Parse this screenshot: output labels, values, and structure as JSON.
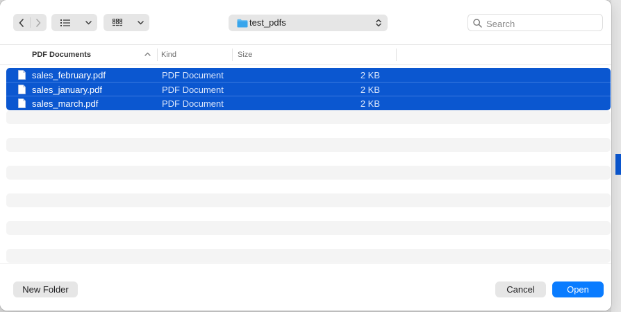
{
  "toolbar": {
    "location": "test_pdfs",
    "search_placeholder": "Search"
  },
  "columns": {
    "name": "PDF Documents",
    "kind": "Kind",
    "size": "Size"
  },
  "files": [
    {
      "name": "sales_february.pdf",
      "kind": "PDF Document",
      "size": "2 KB"
    },
    {
      "name": "sales_january.pdf",
      "kind": "PDF Document",
      "size": "2 KB"
    },
    {
      "name": "sales_march.pdf",
      "kind": "PDF Document",
      "size": "2 KB"
    }
  ],
  "footer": {
    "new_folder": "New Folder",
    "cancel": "Cancel",
    "open": "Open"
  },
  "colors": {
    "selection": "#0b57d0",
    "accent": "#0a7cff"
  }
}
